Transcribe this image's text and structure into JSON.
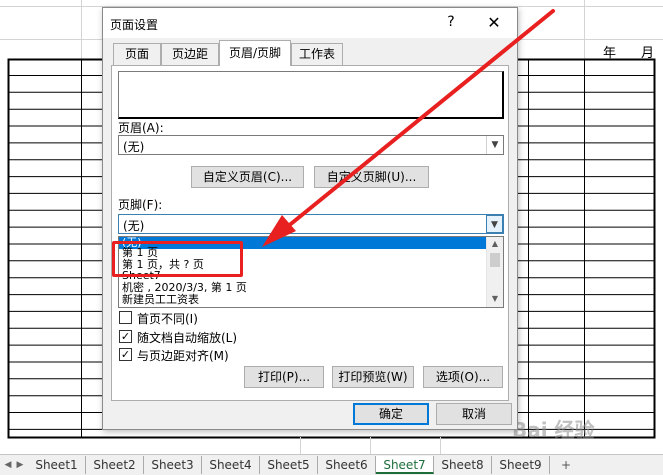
{
  "sheet": {
    "title_partial": "",
    "header_year": "年",
    "header_month": "月"
  },
  "dialog": {
    "title": "页面设置",
    "help_symbol": "?",
    "close_symbol": "✕",
    "tabs": [
      {
        "label": "页面"
      },
      {
        "label": "页边距"
      },
      {
        "label": "页眉/页脚"
      },
      {
        "label": "工作表"
      }
    ],
    "active_tab": "页眉/页脚",
    "header_label": "页眉(A):",
    "header_value": "(无)",
    "custom_header_button": "自定义页眉(C)...",
    "custom_footer_button": "自定义页脚(U)...",
    "footer_label": "页脚(F):",
    "footer_value": "(无)",
    "footer_options": [
      {
        "text": "(无)",
        "selected": true
      },
      {
        "text": "第 1 页",
        "selected": false
      },
      {
        "text": "第 1 页，共 ? 页",
        "selected": false
      },
      {
        "text": "Sheet7",
        "selected": false
      },
      {
        "text": "机密 , 2020/3/3,  第 1 页",
        "selected": false
      },
      {
        "text": "新建员工工资表",
        "selected": false
      }
    ],
    "checkboxes": [
      {
        "label": "首页不同(I)",
        "checked": false
      },
      {
        "label": "随文档自动缩放(L)",
        "checked": true
      },
      {
        "label": "与页边距对齐(M)",
        "checked": true
      }
    ],
    "print_button": "打印(P)...",
    "print_preview_button": "打印预览(W)",
    "options_button": "选项(O)...",
    "ok_button": "确定",
    "cancel_button": "取消",
    "check_mark": "✓"
  },
  "tabs_bar": {
    "sheets": [
      "Sheet1",
      "Sheet2",
      "Sheet3",
      "Sheet4",
      "Sheet5",
      "Sheet6",
      "Sheet7",
      "Sheet8",
      "Sheet9"
    ],
    "active_sheet": "Sheet7",
    "nav_left": "◀",
    "nav_right": "▶",
    "add_symbol": "+"
  },
  "watermark_text": "Bai 经验",
  "colors": {
    "annotation": "#e82020",
    "selection": "#0078d7",
    "active_sheet_tab": "#1e6e3a"
  }
}
